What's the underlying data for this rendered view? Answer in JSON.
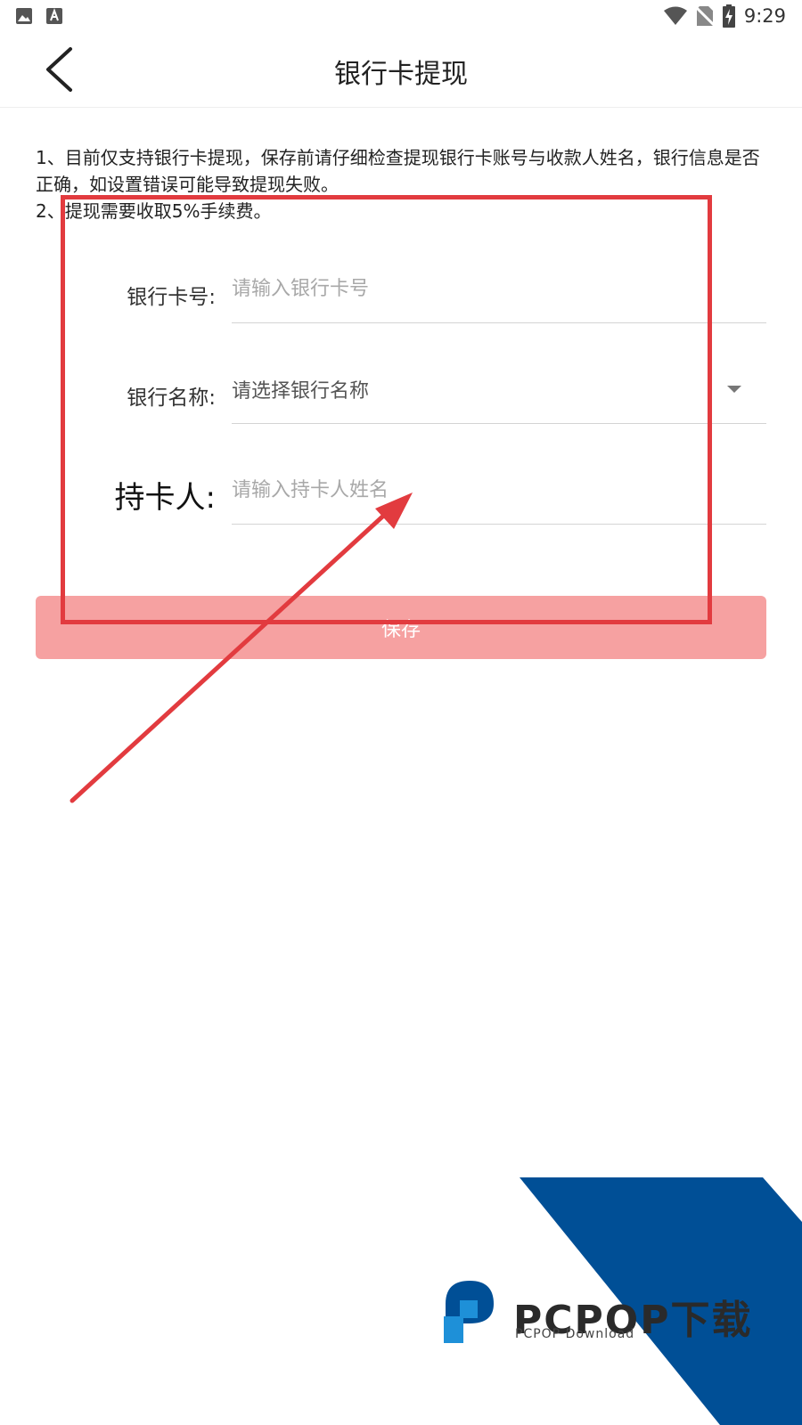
{
  "status_bar": {
    "time": "9:29",
    "left_icons": [
      "image-icon",
      "text-a-icon"
    ],
    "right_icons": [
      "wifi-icon",
      "no-sim-icon",
      "battery-charging-icon"
    ]
  },
  "header": {
    "title": "银行卡提现",
    "back_icon": "chevron-left-icon"
  },
  "notice": {
    "line1": "1、目前仅支持银行卡提现，保存前请仔细检查提现银行卡账号与收款人姓名，银行信息是否正确，如设置错误可能导致提现失败。",
    "line2": "2、提现需要收取5%手续费。"
  },
  "form": {
    "card_number": {
      "label": "银行卡号:",
      "placeholder": "请输入银行卡号",
      "value": ""
    },
    "bank_name": {
      "label": "银行名称:",
      "selected": "请选择银行名称",
      "icon": "caret-down-icon"
    },
    "holder": {
      "label": "持卡人:",
      "placeholder": "请输入持卡人姓名",
      "value": ""
    }
  },
  "save_button": {
    "label": "保存"
  },
  "colors": {
    "save_button_bg": "#f6a1a1",
    "annotation": "#e23b3f",
    "watermark_blue": "#004f96",
    "watermark_logo_blue": "#1e90d8"
  },
  "watermark": {
    "brand": "PCPOP下载",
    "sub": "PCPOP Download"
  }
}
